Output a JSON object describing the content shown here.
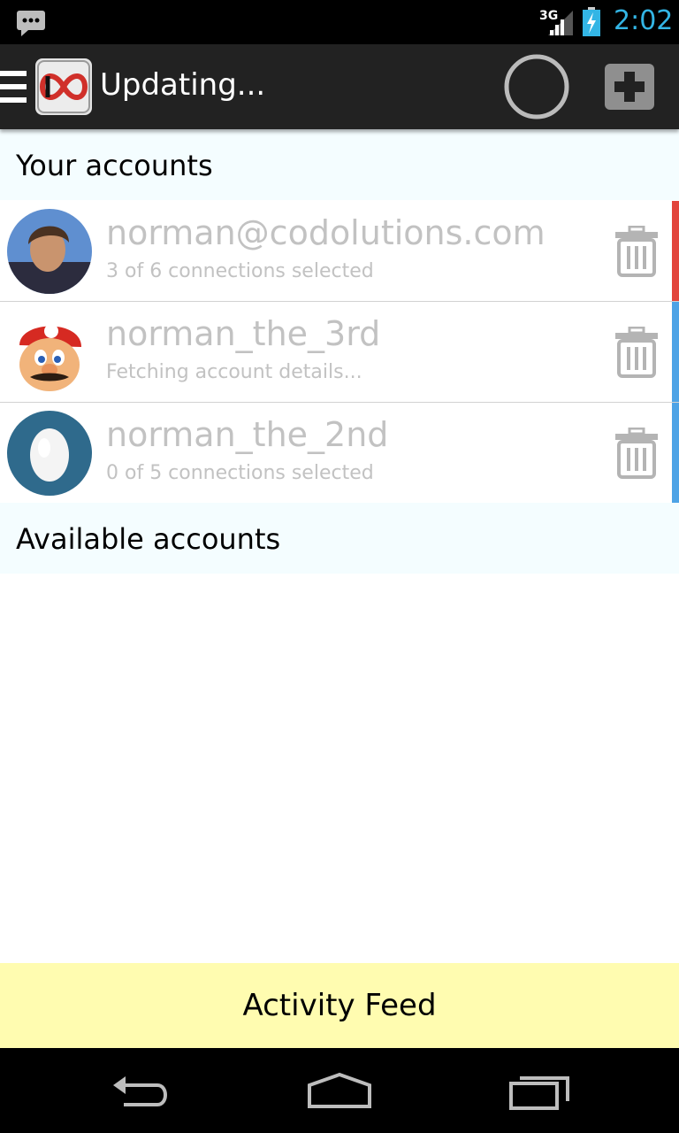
{
  "status_bar": {
    "network_type": "3G",
    "time": "2:02",
    "icons": [
      "message-icon",
      "signal-icon",
      "battery-charging-icon"
    ]
  },
  "action_bar": {
    "title": "Updating...",
    "icons": [
      "drawer-icon",
      "app-logo",
      "loading-spinner",
      "add-icon"
    ]
  },
  "sections": {
    "your_accounts": "Your accounts",
    "available_accounts": "Available accounts"
  },
  "accounts": [
    {
      "name": "norman@codolutions.com",
      "status": "3 of 6 connections selected",
      "stripe_color": "#e2453c",
      "avatar": "photo-avatar"
    },
    {
      "name": "norman_the_3rd",
      "status": "Fetching account details...",
      "stripe_color": "#4da3e6",
      "avatar": "mario-avatar"
    },
    {
      "name": "norman_the_2nd",
      "status": "0 of 5 connections selected",
      "stripe_color": "#4da3e6",
      "avatar": "egg-avatar"
    }
  ],
  "footer": {
    "activity_feed": "Activity Feed"
  },
  "nav_bar": {
    "icons": [
      "back-icon",
      "home-icon",
      "recent-apps-icon"
    ]
  },
  "colors": {
    "status_bar_bg": "#000000",
    "action_bar_bg": "#222222",
    "clock": "#33b5e5",
    "section_bg": "#f4fdff",
    "footer_bg": "#fffcb0",
    "muted_text": "#c2c2c2"
  }
}
